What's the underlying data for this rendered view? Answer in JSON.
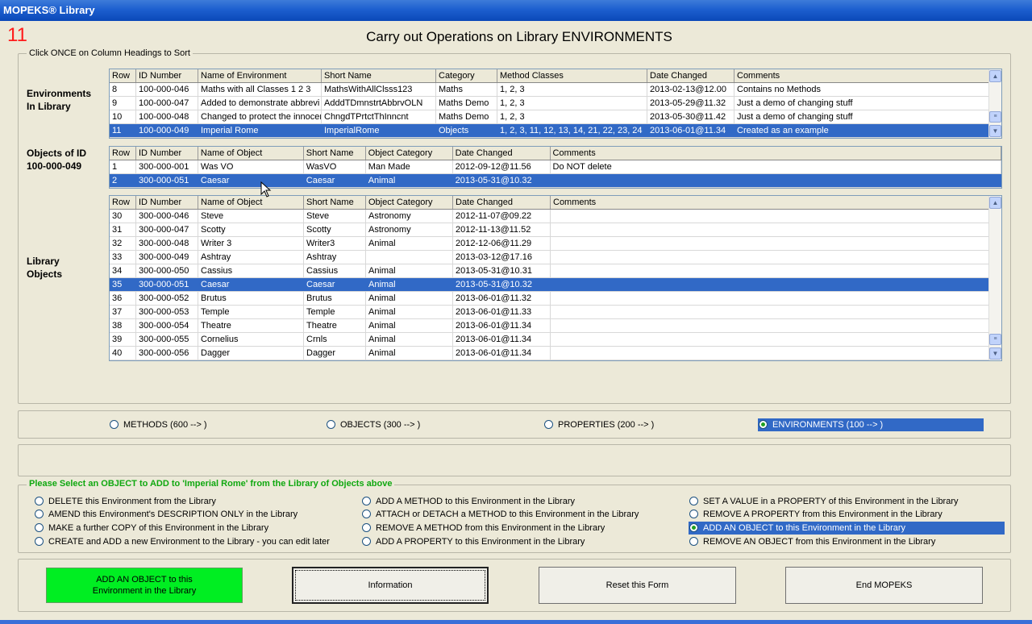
{
  "window": {
    "title": "MOPEKS® Library"
  },
  "form_number": "11",
  "page_title": "Carry out Operations on Library ENVIRONMENTS",
  "lists_group_caption": "Click ONCE on Column Headings to Sort",
  "labels": {
    "environments": [
      "Environments",
      "In Library"
    ],
    "objects_of": [
      "Objects of ID",
      "100-000-049"
    ],
    "library_objects": [
      "Library",
      "Objects"
    ]
  },
  "environments_table": {
    "columns": [
      "Row",
      "ID Number",
      "Name of Environment",
      "Short Name",
      "Category",
      "Method Classes",
      "Date Changed",
      "Comments"
    ],
    "rows": [
      [
        "8",
        "100-000-046",
        "Maths with all Classes 1 2 3",
        "MathsWithAllClsss123",
        "Maths",
        "1, 2, 3",
        "2013-02-13@12.00",
        "Contains no Methods"
      ],
      [
        "9",
        "100-000-047",
        "Added to demonstrate abbrevi",
        "AdddTDmnstrtAbbrvOLN",
        "Maths Demo",
        "1, 2, 3",
        "2013-05-29@11.32",
        "Just a demo of changing stuff"
      ],
      [
        "10",
        "100-000-048",
        "Changed to protect the innocer",
        "ChngdTPrtctThInncnt",
        "Maths Demo",
        "1, 2, 3",
        "2013-05-30@11.42",
        "Just a demo of changing stuff"
      ],
      [
        "11",
        "100-000-049",
        "Imperial Rome",
        "ImperialRome",
        "Objects",
        "1, 2, 3, 11, 12, 13, 14, 21, 22, 23, 24",
        "2013-06-01@11.34",
        "Created as an example"
      ]
    ],
    "selected_row": "11"
  },
  "env_objects_table": {
    "columns": [
      "Row",
      "ID Number",
      "Name of Object",
      "Short Name",
      "Object Category",
      "Date Changed",
      "Comments"
    ],
    "rows": [
      [
        "1",
        "300-000-001",
        "Was VO",
        "WasVO",
        "Man Made",
        "2012-09-12@11.56",
        "Do NOT delete"
      ],
      [
        "2",
        "300-000-051",
        "Caesar",
        "Caesar",
        "Animal",
        "2013-05-31@10.32",
        ""
      ]
    ],
    "selected_row": "2"
  },
  "library_objects_table": {
    "columns": [
      "Row",
      "ID Number",
      "Name of Object",
      "Short Name",
      "Object Category",
      "Date Changed",
      "Comments"
    ],
    "rows": [
      [
        "30",
        "300-000-046",
        "Steve",
        "Steve",
        "Astronomy",
        "2012-11-07@09.22",
        ""
      ],
      [
        "31",
        "300-000-047",
        "Scotty",
        "Scotty",
        "Astronomy",
        "2012-11-13@11.52",
        ""
      ],
      [
        "32",
        "300-000-048",
        "Writer 3",
        "Writer3",
        "Animal",
        "2012-12-06@11.29",
        ""
      ],
      [
        "33",
        "300-000-049",
        "Ashtray",
        "Ashtray",
        "",
        "2013-03-12@17.16",
        ""
      ],
      [
        "34",
        "300-000-050",
        "Cassius",
        "Cassius",
        "Animal",
        "2013-05-31@10.31",
        ""
      ],
      [
        "35",
        "300-000-051",
        "Caesar",
        "Caesar",
        "Animal",
        "2013-05-31@10.32",
        ""
      ],
      [
        "36",
        "300-000-052",
        "Brutus",
        "Brutus",
        "Animal",
        "2013-06-01@11.32",
        ""
      ],
      [
        "37",
        "300-000-053",
        "Temple",
        "Temple",
        "Animal",
        "2013-06-01@11.33",
        ""
      ],
      [
        "38",
        "300-000-054",
        "Theatre",
        "Theatre",
        "Animal",
        "2013-06-01@11.34",
        ""
      ],
      [
        "39",
        "300-000-055",
        "Cornelius",
        "Crnls",
        "Animal",
        "2013-06-01@11.34",
        ""
      ],
      [
        "40",
        "300-000-056",
        "Dagger",
        "Dagger",
        "Animal",
        "2013-06-01@11.34",
        ""
      ]
    ],
    "selected_row": "35"
  },
  "library_types": {
    "options": [
      "METHODS (600 --> )",
      "OBJECTS (300 --> )",
      "PROPERTIES (200 --> )",
      "ENVIRONMENTS (100 --> )"
    ],
    "selected": "ENVIRONMENTS (100 --> )"
  },
  "message": "",
  "operations": {
    "instruction": "Please Select an OBJECT to ADD to 'Imperial Rome' from the Library of Objects above",
    "options": [
      "DELETE this Environment from the Library",
      "AMEND this Environment's DESCRIPTION ONLY in the Library",
      "MAKE a further COPY of this Environment in the Library",
      "CREATE and ADD a new Environment to the Library - you can edit later",
      "ADD A METHOD to this Environment in the Library",
      "ATTACH or DETACH a METHOD to this Environment in the Library",
      "REMOVE A METHOD from this Environment in the Library",
      "ADD A PROPERTY to this Environment in the Library",
      "SET A VALUE in a PROPERTY of this Environment in the Library",
      "REMOVE A PROPERTY from this Environment in the Library",
      "ADD AN OBJECT to this Environment in the Library",
      "REMOVE  AN OBJECT from this Environment in the Library"
    ],
    "selected": "ADD AN OBJECT to this Environment in the Library"
  },
  "buttons": {
    "action": "ADD AN OBJECT to this Environment in the Library",
    "information": "Information",
    "reset": "Reset this Form",
    "end": "End MOPEKS"
  },
  "colors": {
    "selection": "#3169c6",
    "action_button": "#00ee22",
    "instruction_text": "#10a810",
    "form_number": "#ff1a1a"
  },
  "icons": [
    "scroll-up-icon",
    "scroll-down-icon",
    "scroll-thumb-icon",
    "mouse-cursor-icon",
    "radio-button-icon"
  ]
}
